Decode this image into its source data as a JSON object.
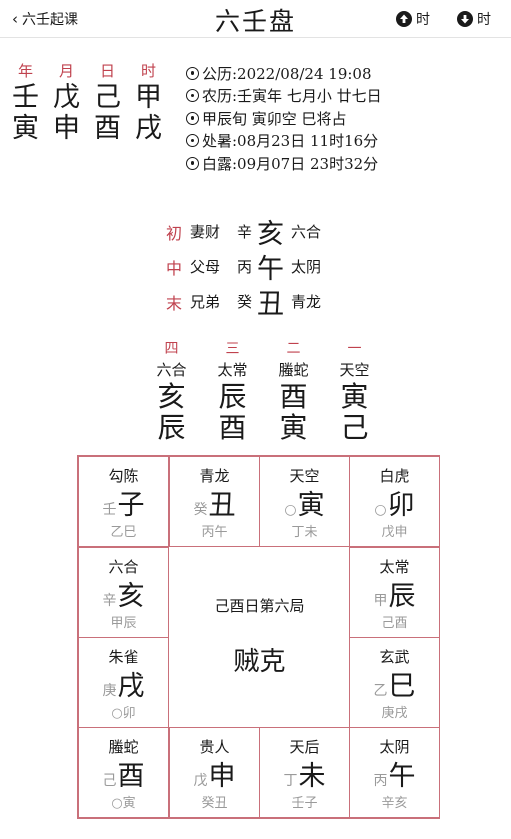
{
  "header": {
    "back_label": "六壬起课",
    "title": "六壬盘",
    "prev_label": "时",
    "next_label": "时"
  },
  "pillars": {
    "labels": [
      "年",
      "月",
      "日",
      "时"
    ],
    "stems": [
      "壬",
      "戊",
      "己",
      "甲"
    ],
    "branches": [
      "寅",
      "申",
      "酉",
      "戌"
    ]
  },
  "info": [
    "公历:2022/08/24 19:08",
    "农历:壬寅年 七月小 廿七日",
    "甲辰旬 寅卯空 巳将占",
    "处暑:08月23日 11时16分",
    "白露:09月07日 23时32分"
  ],
  "chuan": [
    {
      "label": "初",
      "relation": "妻财",
      "gan": "辛",
      "zhi": "亥",
      "god": "六合"
    },
    {
      "label": "中",
      "relation": "父母",
      "gan": "丙",
      "zhi": "午",
      "god": "太阴"
    },
    {
      "label": "末",
      "relation": "兄弟",
      "gan": "癸",
      "zhi": "丑",
      "god": "青龙"
    }
  ],
  "lessons": {
    "numbers": [
      "四",
      "三",
      "二",
      "一"
    ],
    "gods": [
      "六合",
      "太常",
      "螣蛇",
      "天空"
    ],
    "top": [
      "亥",
      "辰",
      "酉",
      "寅"
    ],
    "bottom": [
      "辰",
      "酉",
      "寅",
      "己"
    ]
  },
  "grid": {
    "cells": [
      {
        "god": "勾陈",
        "small": "壬",
        "big": "子",
        "sub": "乙巳"
      },
      {
        "god": "青龙",
        "small": "癸",
        "big": "丑",
        "sub": "丙午"
      },
      {
        "god": "天空",
        "small": "○",
        "big": "寅",
        "sub": "丁未"
      },
      {
        "god": "白虎",
        "small": "○",
        "big": "卯",
        "sub": "戊申"
      },
      {
        "god": "太常",
        "small": "甲",
        "big": "辰",
        "sub": "己酉"
      },
      {
        "god": "玄武",
        "small": "乙",
        "big": "巳",
        "sub": "庚戌"
      },
      {
        "god": "太阴",
        "small": "丙",
        "big": "午",
        "sub": "辛亥"
      },
      {
        "god": "天后",
        "small": "丁",
        "big": "未",
        "sub": "壬子"
      },
      {
        "god": "贵人",
        "small": "戊",
        "big": "申",
        "sub": "癸丑"
      },
      {
        "god": "螣蛇",
        "small": "己",
        "big": "酉",
        "sub": "○寅"
      },
      {
        "god": "朱雀",
        "small": "庚",
        "big": "戌",
        "sub": "○卯"
      },
      {
        "god": "六合",
        "small": "辛",
        "big": "亥",
        "sub": "甲辰"
      }
    ],
    "center_title": "己酉日第六局",
    "center_ke": "贼克"
  }
}
